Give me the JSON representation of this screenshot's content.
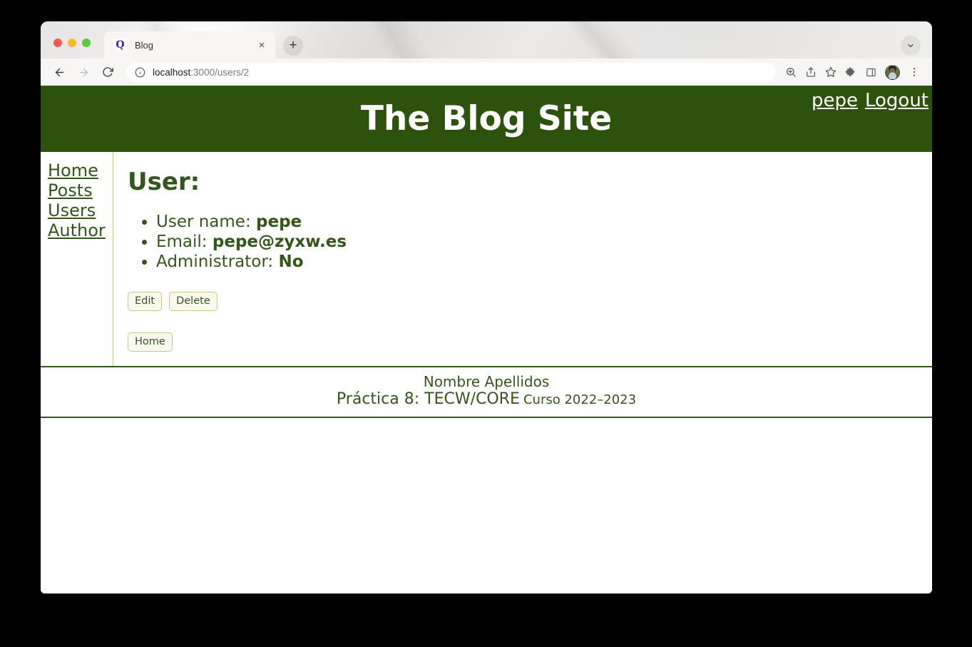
{
  "browser": {
    "tab": {
      "favicon_letter": "Q",
      "title": "Blog",
      "close_label": "×"
    },
    "new_tab_label": "+",
    "url": {
      "host": "localhost",
      "path": ":3000/users/2"
    },
    "icons": {
      "back": "back-arrow-icon",
      "forward": "forward-arrow-icon",
      "reload": "reload-icon",
      "site_info": "info-circle-icon",
      "zoom": "zoom-search-icon",
      "share": "share-icon",
      "bookmark": "star-icon",
      "extensions": "puzzle-piece-icon",
      "side_panel": "side-panel-icon",
      "profile": "profile-avatar-icon",
      "menu": "three-dots-menu-icon",
      "tab_list": "chevron-down-icon"
    }
  },
  "site": {
    "title": "The Blog Site",
    "header_links": [
      {
        "label": "pepe",
        "name": "current-user-link"
      },
      {
        "label": "Logout",
        "name": "logout-link"
      }
    ],
    "accent_green": "#2d520e",
    "text_green": "#33571a",
    "border_olive": "#c8c88a",
    "button_bg": "#faf8ee"
  },
  "sidebar": {
    "items": [
      {
        "label": "Home"
      },
      {
        "label": "Posts"
      },
      {
        "label": "Users"
      },
      {
        "label": "Author"
      }
    ]
  },
  "main": {
    "heading": "User:",
    "details": [
      {
        "label": "User name:",
        "value": "pepe"
      },
      {
        "label": "Email:",
        "value": "pepe@zyxw.es"
      },
      {
        "label": "Administrator:",
        "value": "No"
      }
    ],
    "actions": [
      {
        "label": "Edit"
      },
      {
        "label": "Delete"
      }
    ],
    "secondary_actions": [
      {
        "label": "Home"
      }
    ]
  },
  "footer": {
    "name": "Nombre Apellidos",
    "course_main": "Práctica 8: TECW/CORE",
    "course_sub": "Curso 2022–2023"
  }
}
